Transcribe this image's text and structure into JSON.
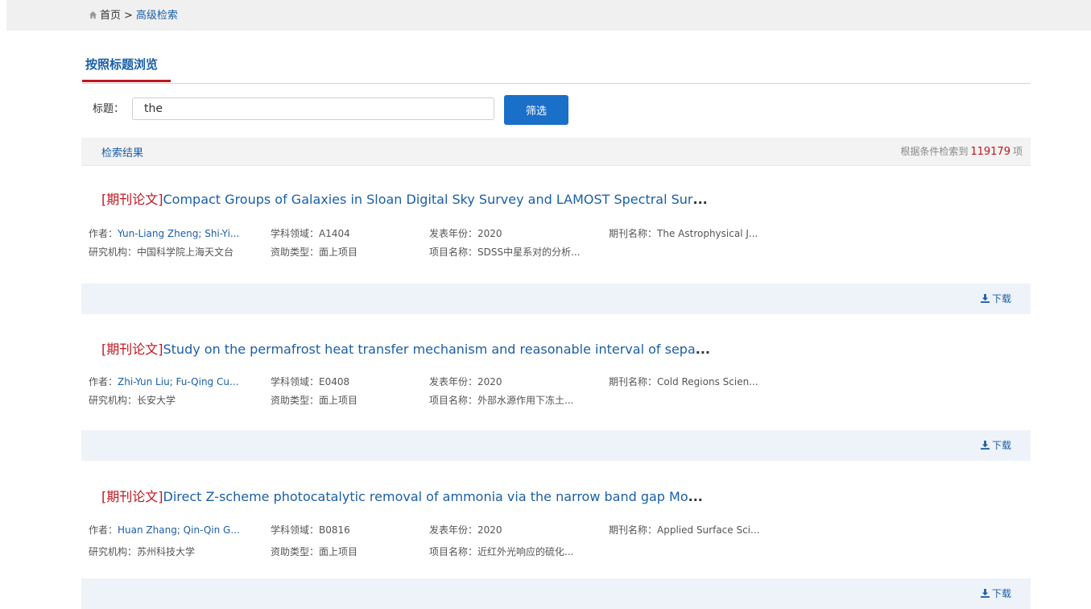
{
  "breadcrumb": {
    "home": "首页",
    "separator": ">",
    "current": "高级检索"
  },
  "tab": {
    "label": "按照标题浏览"
  },
  "search": {
    "label": "标题：",
    "value": "the",
    "button": "筛选"
  },
  "results": {
    "title": "检索结果",
    "prefix": "根据条件检索到",
    "count": "119179",
    "suffix": "项"
  },
  "download_label": "下载",
  "items": [
    {
      "tag": "[期刊论文]",
      "title": "Compact Groups of Galaxies in Sloan Digital Sky Survey and LAMOST Spectral Sur",
      "ellipsis": "...",
      "author_label": "作者：",
      "author": "Yun-Liang Zheng; Shi-Yi...",
      "field_label": "学科领域：",
      "field": "A1404",
      "year_label": "发表年份：",
      "year": "2020",
      "journal_label": "期刊名称：",
      "journal": "The Astrophysical J...",
      "inst_label": "研究机构：",
      "inst": "中国科学院上海天文台",
      "fund_label": "资助类型：",
      "fund": "面上项目",
      "project_label": "项目名称：",
      "project": "SDSS中星系对的分析..."
    },
    {
      "tag": "[期刊论文]",
      "title": "Study on the permafrost heat transfer mechanism and reasonable interval of sepa",
      "ellipsis": "...",
      "author_label": "作者：",
      "author": "Zhi-Yun Liu; Fu-Qing Cu...",
      "field_label": "学科领域：",
      "field": "E0408",
      "year_label": "发表年份：",
      "year": "2020",
      "journal_label": "期刊名称：",
      "journal": "Cold Regions Scien...",
      "inst_label": "研究机构：",
      "inst": "长安大学",
      "fund_label": "资助类型：",
      "fund": "面上项目",
      "project_label": "项目名称：",
      "project": "外部水源作用下冻土..."
    },
    {
      "tag": "[期刊论文]",
      "title": "Direct Z-scheme photocatalytic removal of ammonia via the narrow band gap Mo",
      "ellipsis": "...",
      "author_label": "作者：",
      "author": "Huan Zhang; Qin-Qin G...",
      "field_label": "学科领域：",
      "field": "B0816",
      "year_label": "发表年份：",
      "year": "2020",
      "journal_label": "期刊名称：",
      "journal": "Applied Surface Sci...",
      "inst_label": "研究机构：",
      "inst": "苏州科技大学",
      "fund_label": "资助类型：",
      "fund": "面上项目",
      "project_label": "项目名称：",
      "project": "近红外光响应的硫化..."
    }
  ]
}
